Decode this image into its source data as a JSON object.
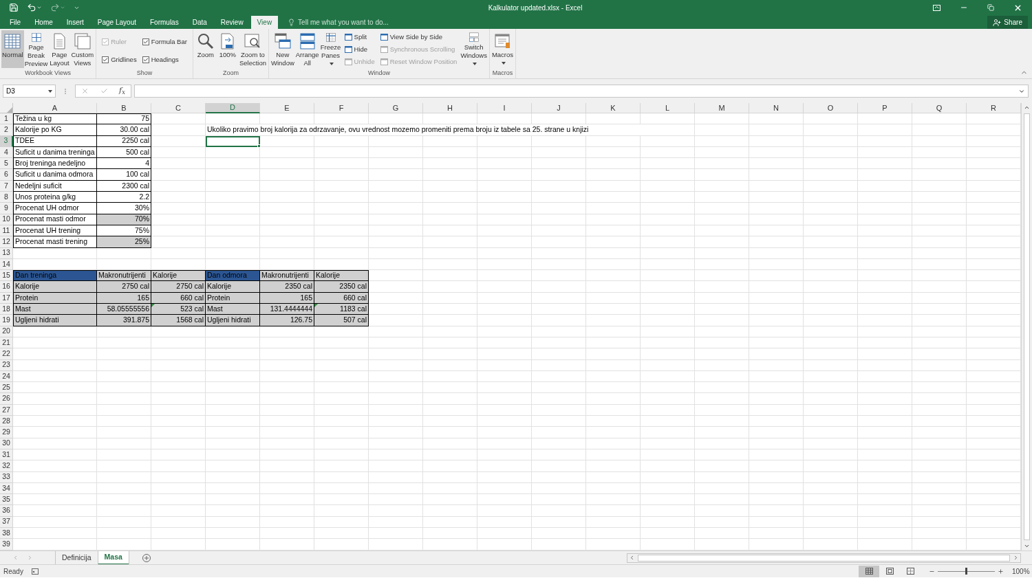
{
  "window": {
    "title": "Kalkulator updated.xlsx - Excel"
  },
  "share": {
    "label": "Share"
  },
  "tabs": [
    {
      "label": "File",
      "selected": false
    },
    {
      "label": "Home",
      "selected": false
    },
    {
      "label": "Insert",
      "selected": false
    },
    {
      "label": "Page Layout",
      "selected": false
    },
    {
      "label": "Formulas",
      "selected": false
    },
    {
      "label": "Data",
      "selected": false
    },
    {
      "label": "Review",
      "selected": false
    },
    {
      "label": "View",
      "selected": true
    }
  ],
  "tell_me": {
    "placeholder": "Tell me what you want to do..."
  },
  "ribbon": {
    "groups": [
      {
        "label": "Workbook Views",
        "items": [
          {
            "kind": "large",
            "label": "Normal",
            "selected": true,
            "disabled": false,
            "menu": false
          },
          {
            "kind": "large",
            "label": "Page Break Preview",
            "selected": false,
            "disabled": false,
            "menu": false
          },
          {
            "kind": "large",
            "label": "Page Layout",
            "selected": false,
            "disabled": false,
            "menu": false
          },
          {
            "kind": "large",
            "label": "Custom Views",
            "selected": false,
            "disabled": false,
            "menu": false
          }
        ]
      },
      {
        "label": "Show",
        "items": [
          {
            "kind": "checks",
            "items": [
              {
                "label": "Ruler",
                "checked": true,
                "disabled": true
              },
              {
                "label": "Formula Bar",
                "checked": true,
                "disabled": false
              },
              {
                "label": "Gridlines",
                "checked": true,
                "disabled": false
              },
              {
                "label": "Headings",
                "checked": true,
                "disabled": false
              }
            ]
          }
        ]
      },
      {
        "label": "Zoom",
        "items": [
          {
            "kind": "large",
            "label": "Zoom",
            "selected": false,
            "disabled": false,
            "menu": false
          },
          {
            "kind": "large",
            "label": "100%",
            "selected": false,
            "disabled": false,
            "menu": false
          },
          {
            "kind": "large",
            "label": "Zoom to Selection",
            "selected": false,
            "disabled": false,
            "menu": false
          }
        ]
      },
      {
        "label": "Window",
        "items": [
          {
            "kind": "large",
            "label": "New Window",
            "selected": false,
            "disabled": false,
            "menu": false
          },
          {
            "kind": "large",
            "label": "Arrange All",
            "selected": false,
            "disabled": false,
            "menu": false
          },
          {
            "kind": "large",
            "label": "Freeze Panes",
            "selected": false,
            "disabled": false,
            "menu": true
          },
          {
            "kind": "stack",
            "items": [
              {
                "label": "Split",
                "disabled": false
              },
              {
                "label": "Hide",
                "disabled": false
              },
              {
                "label": "Unhide",
                "disabled": true
              }
            ]
          },
          {
            "kind": "stack",
            "items": [
              {
                "label": "View Side by Side",
                "disabled": false
              },
              {
                "label": "Synchronous Scrolling",
                "disabled": true
              },
              {
                "label": "Reset Window Position",
                "disabled": true
              }
            ]
          },
          {
            "kind": "large",
            "label": "Switch Windows",
            "selected": false,
            "disabled": false,
            "menu": true
          }
        ]
      },
      {
        "label": "Macros",
        "items": [
          {
            "kind": "large",
            "label": "Macros",
            "selected": false,
            "disabled": false,
            "menu": true
          }
        ]
      }
    ]
  },
  "name_box": {
    "value": "D3"
  },
  "function_button": "f$_{x}$",
  "columns": [
    {
      "label": "A",
      "active": false
    },
    {
      "label": "B",
      "active": false
    },
    {
      "label": "C",
      "active": false
    },
    {
      "label": "D",
      "active": true
    },
    {
      "label": "E",
      "active": false
    },
    {
      "label": "F",
      "active": false
    },
    {
      "label": "G",
      "active": false
    },
    {
      "label": "H",
      "active": false
    },
    {
      "label": "I",
      "active": false
    },
    {
      "label": "J",
      "active": false
    },
    {
      "label": "K",
      "active": false
    },
    {
      "label": "L",
      "active": false
    },
    {
      "label": "M",
      "active": false
    },
    {
      "label": "N",
      "active": false
    },
    {
      "label": "O",
      "active": false
    },
    {
      "label": "P",
      "active": false
    },
    {
      "label": "Q",
      "active": false
    },
    {
      "label": "R",
      "active": false
    }
  ],
  "rows": [
    {
      "number": "1",
      "active": false,
      "cells": [
        {
          "text": "Težina u kg",
          "kind": "text",
          "shaded": false,
          "flagged": false
        },
        {
          "text": "75",
          "kind": "number",
          "shaded": false,
          "flagged": false
        }
      ]
    },
    {
      "number": "2",
      "active": false,
      "cells": [
        {
          "text": "Kalorije po KG",
          "kind": "text",
          "shaded": false,
          "flagged": false
        },
        {
          "text": "30.00 cal",
          "kind": "number",
          "shaded": false,
          "flagged": false
        }
      ],
      "note": "Ukoliko pravimo broj kalorija za odrzavanje, ovu vrednost mozemo promeniti prema broju iz tabele sa 25. strane u knjizi"
    },
    {
      "number": "3",
      "active": true,
      "cells": [
        {
          "text": "TDEE",
          "kind": "text",
          "shaded": false,
          "flagged": false
        },
        {
          "text": "2250 cal",
          "kind": "number",
          "shaded": false,
          "flagged": false
        }
      ]
    },
    {
      "number": "4",
      "active": false,
      "cells": [
        {
          "text": "Suficit u danima treninga",
          "kind": "text",
          "shaded": false,
          "flagged": false
        },
        {
          "text": "500 cal",
          "kind": "number",
          "shaded": false,
          "flagged": false
        }
      ]
    },
    {
      "number": "5",
      "active": false,
      "cells": [
        {
          "text": "Broj treninga nedeljno",
          "kind": "text",
          "shaded": false,
          "flagged": false
        },
        {
          "text": "4",
          "kind": "number",
          "shaded": false,
          "flagged": false
        }
      ]
    },
    {
      "number": "6",
      "active": false,
      "cells": [
        {
          "text": "Suficit u danima odmora",
          "kind": "text",
          "shaded": false,
          "flagged": false
        },
        {
          "text": "100 cal",
          "kind": "number",
          "shaded": false,
          "flagged": false
        }
      ]
    },
    {
      "number": "7",
      "active": false,
      "cells": [
        {
          "text": "Nedeljni suficit",
          "kind": "text",
          "shaded": false,
          "flagged": false
        },
        {
          "text": "2300 cal",
          "kind": "number",
          "shaded": false,
          "flagged": false
        }
      ]
    },
    {
      "number": "8",
      "active": false,
      "cells": [
        {
          "text": "Unos proteina g/kg",
          "kind": "text",
          "shaded": false,
          "flagged": false
        },
        {
          "text": "2.2",
          "kind": "number",
          "shaded": false,
          "flagged": false
        }
      ]
    },
    {
      "number": "9",
      "active": false,
      "cells": [
        {
          "text": "Procenat UH odmor",
          "kind": "text",
          "shaded": false,
          "flagged": false
        },
        {
          "text": "30%",
          "kind": "number",
          "shaded": false,
          "flagged": false
        }
      ]
    },
    {
      "number": "10",
      "active": false,
      "cells": [
        {
          "text": "Procenat masti odmor",
          "kind": "text",
          "shaded": false,
          "flagged": false
        },
        {
          "text": "70%",
          "kind": "number",
          "shaded": true,
          "flagged": false
        }
      ]
    },
    {
      "number": "11",
      "active": false,
      "cells": [
        {
          "text": "Procenat UH trening",
          "kind": "text",
          "shaded": false,
          "flagged": false
        },
        {
          "text": "75%",
          "kind": "number",
          "shaded": false,
          "flagged": false
        }
      ]
    },
    {
      "number": "12",
      "active": false,
      "cells": [
        {
          "text": "Procenat masti trening",
          "kind": "text",
          "shaded": false,
          "flagged": false
        },
        {
          "text": "25%",
          "kind": "number",
          "shaded": true,
          "flagged": false
        }
      ]
    },
    {
      "number": "13",
      "active": false,
      "cells": []
    },
    {
      "number": "14",
      "active": false,
      "cells": []
    },
    {
      "number": "15",
      "active": false,
      "cells": [
        {
          "text": "Dan treninga",
          "kind": "heading",
          "flagged": false
        },
        {
          "text": "Makronutrijenti",
          "kind": "text",
          "shaded": true,
          "flagged": false
        },
        {
          "text": "Kalorije",
          "kind": "text",
          "shaded": true,
          "flagged": false
        },
        {
          "text": "Dan odmora",
          "kind": "heading",
          "flagged": false
        },
        {
          "text": "Makronutrijenti",
          "kind": "text",
          "shaded": true,
          "flagged": false
        },
        {
          "text": "Kalorije",
          "kind": "text",
          "shaded": true,
          "flagged": false
        }
      ]
    },
    {
      "number": "16",
      "active": false,
      "cells": [
        {
          "text": "Kalorije",
          "kind": "text",
          "shaded": true,
          "flagged": false
        },
        {
          "text": "2750 cal",
          "kind": "number",
          "shaded": true,
          "flagged": false
        },
        {
          "text": "2750 cal",
          "kind": "number",
          "shaded": true,
          "flagged": false
        },
        {
          "text": "Kalorije",
          "kind": "text",
          "shaded": true,
          "flagged": false
        },
        {
          "text": "2350 cal",
          "kind": "number",
          "shaded": true,
          "flagged": false
        },
        {
          "text": "2350 cal",
          "kind": "number",
          "shaded": true,
          "flagged": false
        }
      ]
    },
    {
      "number": "17",
      "active": false,
      "cells": [
        {
          "text": "Protein",
          "kind": "text",
          "shaded": true,
          "flagged": false
        },
        {
          "text": "165",
          "kind": "number",
          "shaded": true,
          "flagged": false
        },
        {
          "text": "660 cal",
          "kind": "number",
          "shaded": true,
          "flagged": false
        },
        {
          "text": "Protein",
          "kind": "text",
          "shaded": true,
          "flagged": false
        },
        {
          "text": "165",
          "kind": "number",
          "shaded": true,
          "flagged": false
        },
        {
          "text": "660 cal",
          "kind": "number",
          "shaded": true,
          "flagged": false
        }
      ]
    },
    {
      "number": "18",
      "active": false,
      "cells": [
        {
          "text": "Mast",
          "kind": "text",
          "shaded": true,
          "flagged": false
        },
        {
          "text": "58.05555556",
          "kind": "number",
          "shaded": true,
          "flagged": false
        },
        {
          "text": "523 cal",
          "kind": "number",
          "shaded": true,
          "flagged": true
        },
        {
          "text": "Mast",
          "kind": "text",
          "shaded": true,
          "flagged": false
        },
        {
          "text": "131.4444444",
          "kind": "number",
          "shaded": true,
          "flagged": false
        },
        {
          "text": "1183 cal",
          "kind": "number",
          "shaded": true,
          "flagged": true
        }
      ]
    },
    {
      "number": "19",
      "active": false,
      "cells": [
        {
          "text": "Ugljeni hidrati",
          "kind": "text",
          "shaded": true,
          "flagged": false
        },
        {
          "text": "391.875",
          "kind": "number",
          "shaded": true,
          "flagged": false
        },
        {
          "text": "1568 cal",
          "kind": "number",
          "shaded": true,
          "flagged": false
        },
        {
          "text": "Ugljeni hidrati",
          "kind": "text",
          "shaded": true,
          "flagged": false
        },
        {
          "text": "126.75",
          "kind": "number",
          "shaded": true,
          "flagged": false
        },
        {
          "text": "507 cal",
          "kind": "number",
          "shaded": true,
          "flagged": false
        }
      ]
    },
    {
      "number": "20",
      "active": false,
      "cells": []
    },
    {
      "number": "21",
      "active": false,
      "cells": []
    },
    {
      "number": "22",
      "active": false,
      "cells": []
    },
    {
      "number": "23",
      "active": false,
      "cells": []
    },
    {
      "number": "24",
      "active": false,
      "cells": []
    },
    {
      "number": "25",
      "active": false,
      "cells": []
    },
    {
      "number": "26",
      "active": false,
      "cells": []
    },
    {
      "number": "27",
      "active": false,
      "cells": []
    },
    {
      "number": "28",
      "active": false,
      "cells": []
    },
    {
      "number": "29",
      "active": false,
      "cells": []
    },
    {
      "number": "30",
      "active": false,
      "cells": []
    },
    {
      "number": "31",
      "active": false,
      "cells": []
    },
    {
      "number": "32",
      "active": false,
      "cells": []
    },
    {
      "number": "33",
      "active": false,
      "cells": []
    },
    {
      "number": "34",
      "active": false,
      "cells": []
    },
    {
      "number": "35",
      "active": false,
      "cells": []
    },
    {
      "number": "36",
      "active": false,
      "cells": []
    },
    {
      "number": "37",
      "active": false,
      "cells": []
    },
    {
      "number": "38",
      "active": false,
      "cells": []
    },
    {
      "number": "39",
      "active": false,
      "cells": []
    }
  ],
  "sheet_tabs": [
    {
      "label": "Definicija",
      "selected": false
    },
    {
      "label": "Masa",
      "selected": true
    }
  ],
  "status_bar": {
    "status": "Ready",
    "views": [
      {
        "kind": "normal",
        "selected": true
      },
      {
        "kind": "page-layout",
        "selected": false
      },
      {
        "kind": "page-break",
        "selected": false
      }
    ],
    "zoom": {
      "level": 0.5,
      "reading": "100%"
    }
  }
}
